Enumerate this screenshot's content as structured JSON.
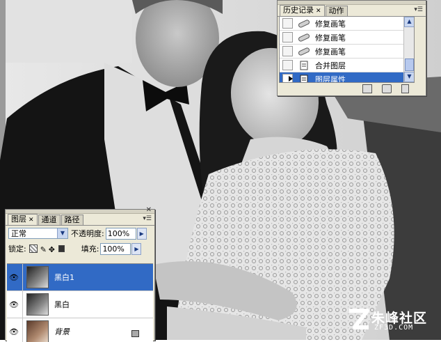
{
  "history_panel": {
    "tabs": [
      {
        "label": "历史记录",
        "active": true
      },
      {
        "label": "动作",
        "active": false
      }
    ],
    "items": [
      {
        "label": "修复画笔",
        "selected": false
      },
      {
        "label": "修复画笔",
        "selected": false
      },
      {
        "label": "修复画笔",
        "selected": false
      },
      {
        "label": "合并图层",
        "selected": false
      },
      {
        "label": "图层属性",
        "selected": true
      }
    ]
  },
  "layers_panel": {
    "tabs": [
      {
        "label": "图层",
        "active": true
      },
      {
        "label": "通道",
        "active": false
      },
      {
        "label": "路径",
        "active": false
      }
    ],
    "blend_mode": "正常",
    "opacity_label": "不透明度:",
    "opacity_value": "100%",
    "lock_label": "锁定:",
    "fill_label": "填充:",
    "fill_value": "100%",
    "layers": [
      {
        "name": "黑白1",
        "selected": true,
        "locked": false
      },
      {
        "name": "黑白",
        "selected": false,
        "locked": false
      },
      {
        "name": "背景",
        "selected": false,
        "locked": true
      }
    ]
  },
  "watermark": {
    "text": "朱峰社区",
    "sub": "ZF3D.COM"
  }
}
